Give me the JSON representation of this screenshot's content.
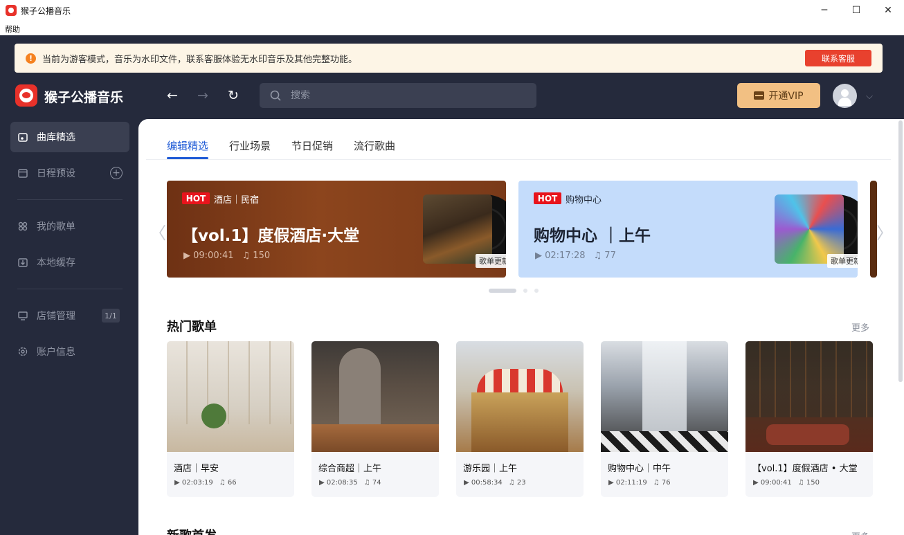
{
  "window": {
    "title": "猴子公播音乐",
    "minimize": "─",
    "maximize": "☐",
    "close": "✕"
  },
  "menu": {
    "help": "帮助"
  },
  "notice": {
    "icon": "!",
    "text": "当前为游客模式，音乐为水印文件，联系客服体验无水印音乐及其他完整功能。",
    "button": "联系客服"
  },
  "header": {
    "brand": "猴子公播音乐",
    "back": "←",
    "forward": "→",
    "refresh": "↻",
    "search_placeholder": "搜索",
    "vip_button": "开通VIP",
    "chevron": "⌵"
  },
  "sidebar": {
    "items": [
      {
        "label": "曲库精选"
      },
      {
        "label": "日程预设",
        "action": "+"
      },
      {
        "label": "我的歌单"
      },
      {
        "label": "本地缓存"
      },
      {
        "label": "店铺管理",
        "badge": "1/1"
      },
      {
        "label": "账户信息"
      }
    ]
  },
  "tabs": [
    "编辑精选",
    "行业场景",
    "节日促销",
    "流行歌曲"
  ],
  "carousel": {
    "prev": "〈",
    "next": "〉",
    "banners": [
      {
        "tag": "HOT",
        "category": "酒店｜民宿",
        "title": "【vol.1】度假酒店·大堂",
        "duration": "▶ 09:00:41",
        "count": "♫ 150",
        "update": "歌单更新"
      },
      {
        "tag": "HOT",
        "category": "购物中心",
        "title": "购物中心 ｜上午",
        "duration": "▶ 02:17:28",
        "count": "♫ 77",
        "update": "歌单更新"
      }
    ]
  },
  "hot_section": {
    "title": "热门歌单",
    "more": "更多",
    "cards": [
      {
        "title": "酒店｜早安",
        "duration": "▶ 02:03:19",
        "count": "♫ 66"
      },
      {
        "title": "综合商超｜上午",
        "duration": "▶ 02:08:35",
        "count": "♫ 74"
      },
      {
        "title": "游乐园｜上午",
        "duration": "▶ 00:58:34",
        "count": "♫ 23"
      },
      {
        "title": "购物中心｜中午",
        "duration": "▶ 02:11:19",
        "count": "♫ 76"
      },
      {
        "title": "【vol.1】度假酒店 • 大堂",
        "duration": "▶ 09:00:41",
        "count": "♫ 150"
      }
    ]
  },
  "new_section": {
    "title": "新歌首发",
    "more": "更多"
  },
  "colors": {
    "accent": "#1f5bd6",
    "sidebar_bg": "#252a3c",
    "notice_button": "#e8412e",
    "vip": "#f2c083"
  }
}
